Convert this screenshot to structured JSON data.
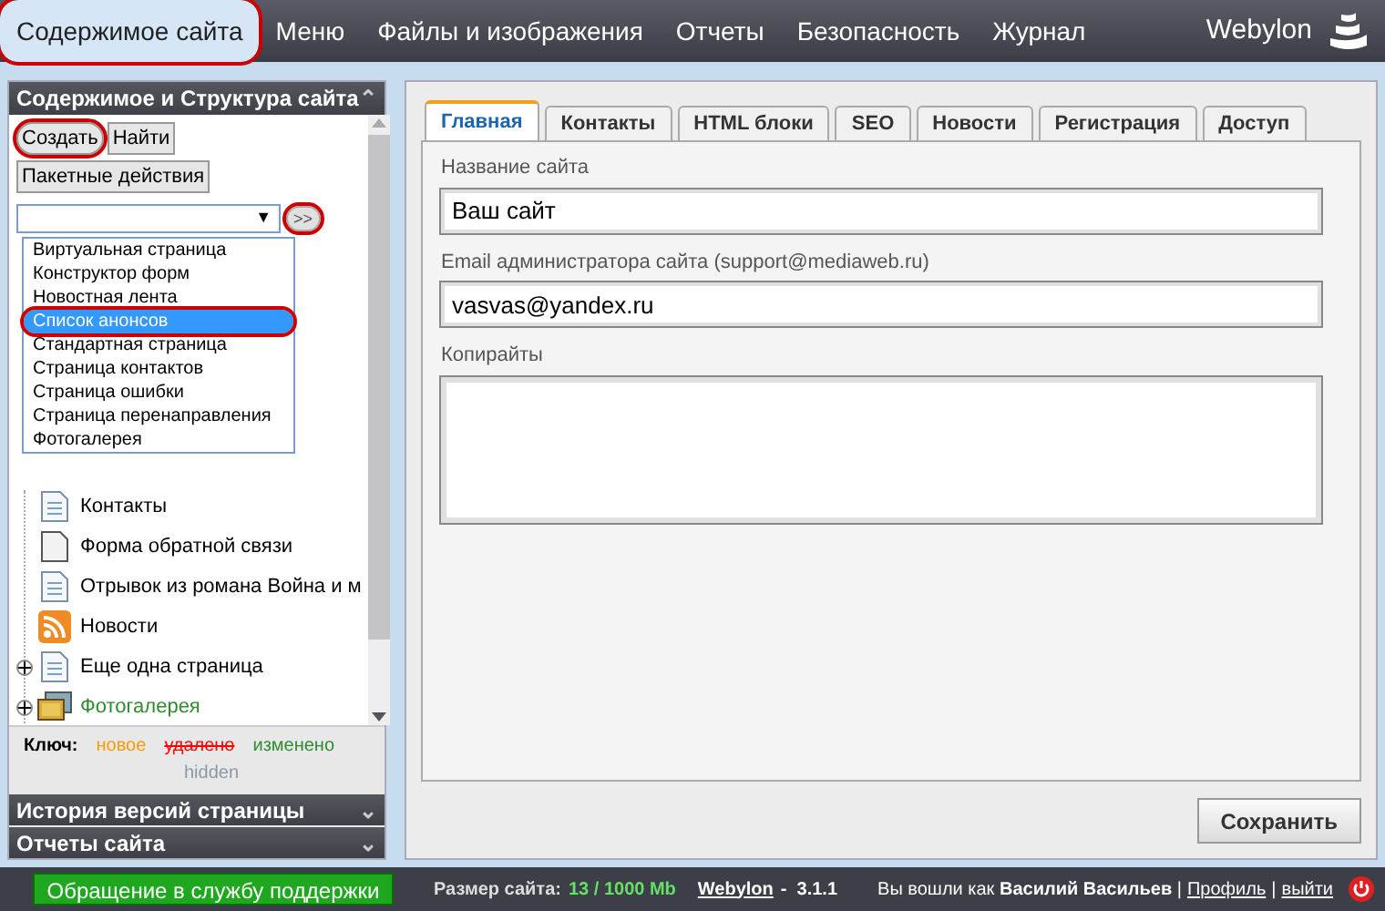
{
  "nav": {
    "items": [
      {
        "label": "Содержимое сайта",
        "selected": true,
        "circled": true
      },
      {
        "label": "Меню",
        "selected": false,
        "circled": false
      },
      {
        "label": "Файлы и изображения",
        "selected": false,
        "circled": false
      },
      {
        "label": "Отчеты",
        "selected": false,
        "circled": false
      },
      {
        "label": "Безопасность",
        "selected": false,
        "circled": false
      },
      {
        "label": "Журнал",
        "selected": false,
        "circled": false
      }
    ],
    "brand": "Webylon"
  },
  "sidebar": {
    "title": "Содержимое и Структура сайта",
    "toggle": "⌃",
    "buttons": [
      {
        "label": "Создать",
        "circled": true
      },
      {
        "label": "Найти",
        "circled": false
      }
    ],
    "batch_button": "Пакетные действия",
    "select": {
      "arrow": "▼"
    },
    "go_button": {
      "label": ">>",
      "circled": true
    },
    "dropdown": [
      {
        "label": "Виртуальная страница",
        "selected": false,
        "circled": false
      },
      {
        "label": "Конструктор форм",
        "selected": false,
        "circled": false
      },
      {
        "label": "Новостная лента",
        "selected": false,
        "circled": false
      },
      {
        "label": "Список анонсов",
        "selected": true,
        "circled": true
      },
      {
        "label": "Стандартная страница",
        "selected": false,
        "circled": false
      },
      {
        "label": "Страница контактов",
        "selected": false,
        "circled": false
      },
      {
        "label": "Страница ошибки",
        "selected": false,
        "circled": false
      },
      {
        "label": "Страница перенаправления",
        "selected": false,
        "circled": false
      },
      {
        "label": "Фотогалерея",
        "selected": false,
        "circled": false
      }
    ],
    "tree": [
      {
        "label": "Контакты",
        "kind": "page",
        "changed": false,
        "expandable": false
      },
      {
        "label": "Форма обратной связи",
        "kind": "form",
        "changed": false,
        "expandable": false
      },
      {
        "label": "Отрывок из романа Война и м",
        "kind": "page",
        "changed": false,
        "expandable": false
      },
      {
        "label": "Новости",
        "kind": "rss",
        "changed": false,
        "expandable": false
      },
      {
        "label": "Еще одна страница",
        "kind": "page",
        "changed": false,
        "expandable": true
      },
      {
        "label": "Фотогалерея",
        "kind": "gallery",
        "changed": true,
        "expandable": true
      }
    ],
    "legend": {
      "label": "Ключ:",
      "items": [
        {
          "label": "новое",
          "kind": "new"
        },
        {
          "label": "удалено",
          "kind": "deleted"
        },
        {
          "label": "изменено",
          "kind": "changed"
        },
        {
          "label": "hidden",
          "kind": "hidden"
        }
      ]
    },
    "accordions": [
      {
        "title": "История версий страницы",
        "toggle": "⌄"
      },
      {
        "title": "Отчеты сайта",
        "toggle": "⌄"
      }
    ]
  },
  "main": {
    "tabs": [
      {
        "label": "Главная",
        "selected": true
      },
      {
        "label": "Контакты",
        "selected": false
      },
      {
        "label": "HTML блоки",
        "selected": false
      },
      {
        "label": "SEO",
        "selected": false
      },
      {
        "label": "Новости",
        "selected": false
      },
      {
        "label": "Регистрация",
        "selected": false
      },
      {
        "label": "Доступ",
        "selected": false
      }
    ],
    "fields": [
      {
        "label": "Название сайта",
        "value": "Ваш сайт",
        "kind": "input"
      },
      {
        "label": "Email администратора сайта (support@mediaweb.ru)",
        "value": "vasvas@yandex.ru",
        "kind": "input"
      },
      {
        "label": "Копирайты",
        "kind": "textarea"
      }
    ],
    "save_button": "Сохранить"
  },
  "status_bar": {
    "support_button": "Обращение в службу поддержки",
    "size_label": "Размер сайта:",
    "size_value": "13 / 1000 Mb",
    "product_link": "Webylon",
    "version": "-  3.1.1",
    "login_text": "Вы вошли как **Василий Васильев** |",
    "profile_link": "Профиль",
    "separator": "|",
    "logout_link": "выйти"
  }
}
